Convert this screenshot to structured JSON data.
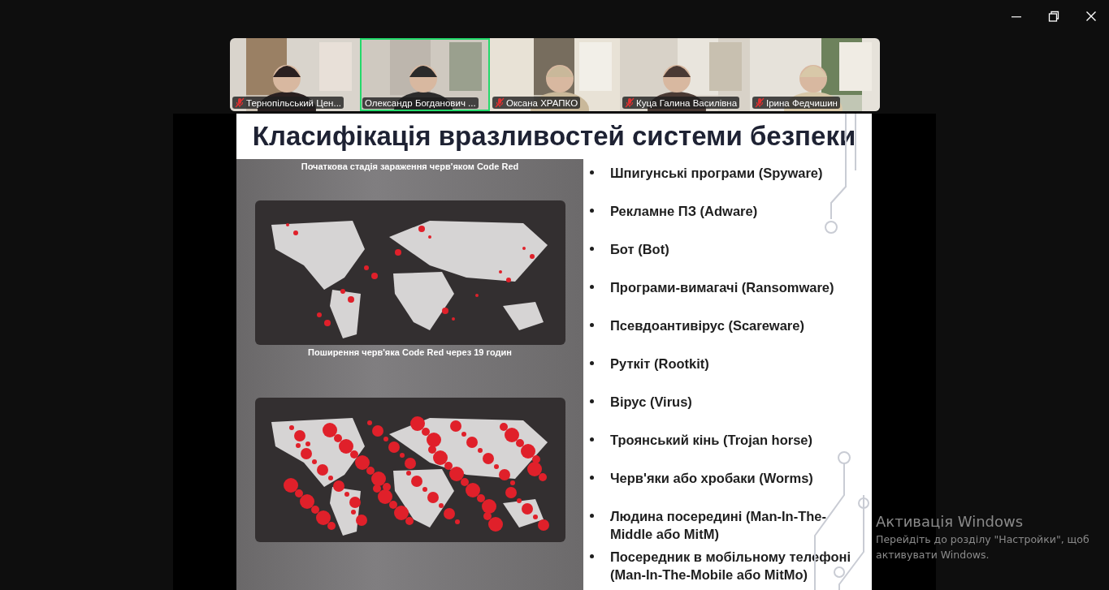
{
  "participants": [
    {
      "name": "Тернопільський Цен...",
      "muted": true,
      "speaking": false
    },
    {
      "name": "Олександр Богданович ...",
      "muted": false,
      "speaking": true
    },
    {
      "name": "Оксана ХРАПКО",
      "muted": true,
      "speaking": false
    },
    {
      "name": "Куца Галина Василівна",
      "muted": true,
      "speaking": false
    },
    {
      "name": "Ірина Федчишин",
      "muted": true,
      "speaking": false
    }
  ],
  "slide": {
    "title": "Класифікація вразливостей системи безпеки",
    "figures": [
      {
        "caption": "Початкова стадія зараження черв'яком Code Red",
        "kind": "picture"
      },
      {
        "caption": "Поширення черв'яка Code Red через 19 годин",
        "kind": "picture"
      }
    ],
    "bullets": [
      "Шпигунські програми (Spyware)",
      "Рекламне ПЗ (Adware)",
      "Бот (Bot)",
      "Програми-вимагачі (Ransomware)",
      "Псевдоантивірус (Scareware)",
      "Руткіт (Rootkit)",
      "Вірус (Virus)",
      "Троянський кінь (Trojan horse)",
      "Черв'яки або хробаки (Worms)",
      "Людина посередині (Man-In-The-Middle або MitM)",
      "Посередник в мобільному телефоні (Man-In-The-Mobile або MitMo)"
    ]
  },
  "activation_notice": {
    "title": "Активація Windows",
    "text": "Перейдіть до розділу \"Настройки\", щоб активувати Windows."
  }
}
